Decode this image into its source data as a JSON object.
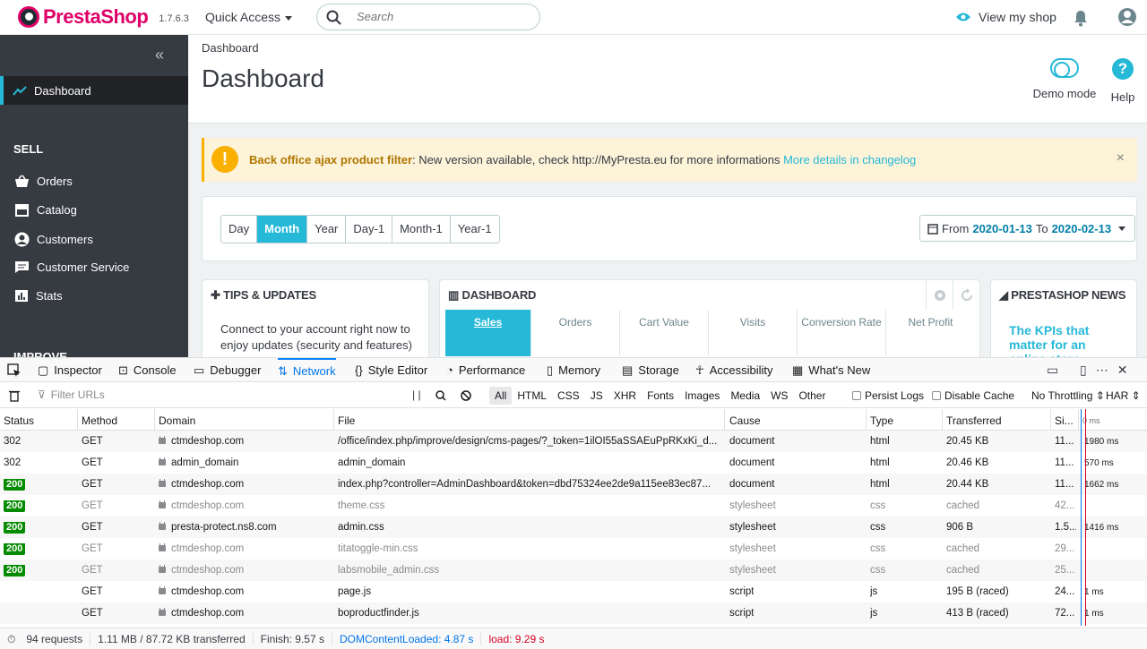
{
  "topbar": {
    "logo_text": "PrestaShop",
    "version": "1.7.6.3",
    "quick_access": "Quick Access",
    "search_placeholder": "Search",
    "view_shop": "View my shop"
  },
  "sidebar": {
    "dashboard": "Dashboard",
    "sell_heading": "SELL",
    "items": [
      "Orders",
      "Catalog",
      "Customers",
      "Customer Service",
      "Stats"
    ],
    "improve_heading": "IMPROVE"
  },
  "header": {
    "breadcrumb": "Dashboard",
    "title": "Dashboard",
    "demo_mode": "Demo mode",
    "help": "Help"
  },
  "alert": {
    "title": "Back office ajax product filter",
    "message": ": New version available, check http://MyPresta.eu for more informations ",
    "link": "More details in changelog",
    "close": "×"
  },
  "periods": {
    "buttons": [
      "Day",
      "Month",
      "Year",
      "Day-1",
      "Month-1",
      "Year-1"
    ],
    "active": "Month",
    "from_label": "From",
    "from": "2020-01-13",
    "to_label": "To",
    "to": "2020-02-13"
  },
  "tips": {
    "title": "TIPS & UPDATES",
    "text": "Connect to your account right now to enjoy updates (security and features)"
  },
  "dashboard_panel": {
    "title": "DASHBOARD",
    "tabs": [
      "Sales",
      "Orders",
      "Cart Value",
      "Visits",
      "Conversion Rate",
      "Net Profit"
    ]
  },
  "news": {
    "title": "PRESTASHOP NEWS",
    "headline": "The KPIs that matter for an online store"
  },
  "devtools": {
    "tabs": [
      "Inspector",
      "Console",
      "Debugger",
      "Network",
      "Style Editor",
      "Performance",
      "Memory",
      "Storage",
      "Accessibility",
      "What's New"
    ],
    "active_tab": "Network",
    "filter_placeholder": "Filter URLs",
    "types": [
      "All",
      "HTML",
      "CSS",
      "JS",
      "XHR",
      "Fonts",
      "Images",
      "Media",
      "WS",
      "Other"
    ],
    "persist_logs": "Persist Logs",
    "disable_cache": "Disable Cache",
    "throttling": "No Throttling ⇕",
    "har": "HAR ⇕",
    "columns": [
      "Status",
      "Method",
      "Domain",
      "File",
      "Cause",
      "Type",
      "Transferred",
      "Si...",
      "0 ms"
    ],
    "rows": [
      {
        "status": "302",
        "method": "GET",
        "domain": "ctmdeshop.com",
        "file": "/office/index.php/improve/design/cms-pages/?_token=1ilOI55aSSAEuPpRKxKi_d...",
        "cause": "document",
        "type": "html",
        "transferred": "20.45 KB",
        "size": "11...",
        "timing": "1980 ms",
        "dim": false,
        "badge": false
      },
      {
        "status": "302",
        "method": "GET",
        "domain": "admin_domain",
        "file": "admin_domain",
        "cause": "document",
        "type": "html",
        "transferred": "20.46 KB",
        "size": "11...",
        "timing": "570 ms",
        "dim": false,
        "badge": false
      },
      {
        "status": "200",
        "method": "GET",
        "domain": "ctmdeshop.com",
        "file": "index.php?controller=AdminDashboard&token=dbd75324ee2de9a115ee83ec87...",
        "cause": "document",
        "type": "html",
        "transferred": "20.44 KB",
        "size": "11...",
        "timing": "1662 ms",
        "dim": false,
        "badge": true
      },
      {
        "status": "200",
        "method": "GET",
        "domain": "ctmdeshop.com",
        "file": "theme.css",
        "cause": "stylesheet",
        "type": "css",
        "transferred": "cached",
        "size": "42...",
        "timing": "",
        "dim": true,
        "badge": true
      },
      {
        "status": "200",
        "method": "GET",
        "domain": "presta-protect.ns8.com",
        "file": "admin.css",
        "cause": "stylesheet",
        "type": "css",
        "transferred": "906 B",
        "size": "1.5...",
        "timing": "1416 ms",
        "dim": false,
        "badge": true
      },
      {
        "status": "200",
        "method": "GET",
        "domain": "ctmdeshop.com",
        "file": "titatoggle-min.css",
        "cause": "stylesheet",
        "type": "css",
        "transferred": "cached",
        "size": "29...",
        "timing": "",
        "dim": true,
        "badge": true
      },
      {
        "status": "200",
        "method": "GET",
        "domain": "ctmdeshop.com",
        "file": "labsmobile_admin.css",
        "cause": "stylesheet",
        "type": "css",
        "transferred": "cached",
        "size": "25...",
        "timing": "",
        "dim": true,
        "badge": true
      },
      {
        "status": "",
        "method": "GET",
        "domain": "ctmdeshop.com",
        "file": "page.js",
        "cause": "script",
        "type": "js",
        "transferred": "195 B (raced)",
        "size": "24...",
        "timing": "1 ms",
        "dim": false,
        "badge": false
      },
      {
        "status": "",
        "method": "GET",
        "domain": "ctmdeshop.com",
        "file": "boproductfinder.js",
        "cause": "script",
        "type": "js",
        "transferred": "413 B (raced)",
        "size": "72...",
        "timing": "1 ms",
        "dim": false,
        "badge": false
      }
    ],
    "status_bar": {
      "requests": "94 requests",
      "transferred": "1.11 MB / 87.72 KB transferred",
      "finish": "Finish: 9.57 s",
      "dom_loaded": "DOMContentLoaded: 4.87 s",
      "load": "load: 9.29 s"
    }
  },
  "colors": {
    "accent": "#25b9d7",
    "brand": "#df0067",
    "sidebar": "#363a41",
    "status_ok": "#058b00",
    "dom_loaded": "#0074e8",
    "load": "#d70022"
  }
}
